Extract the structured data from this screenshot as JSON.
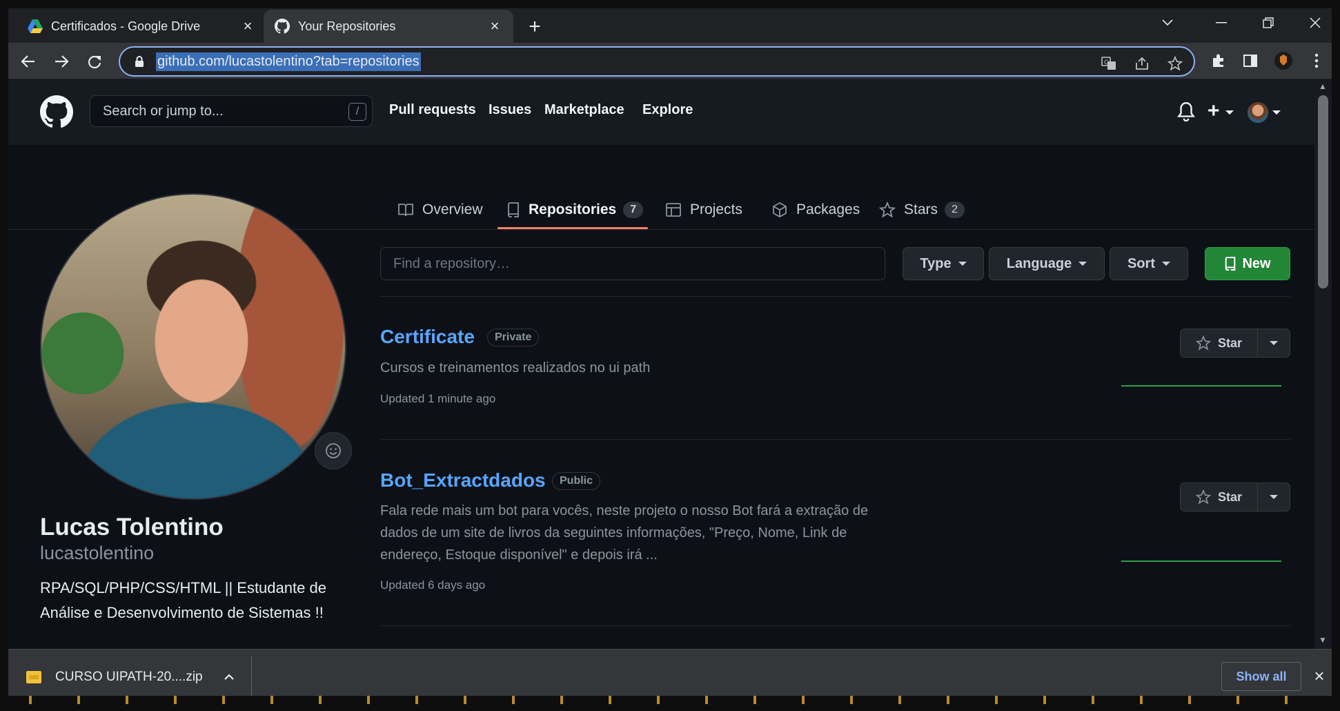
{
  "browser": {
    "tabs": [
      {
        "title": "Certificados - Google Drive",
        "icon": "google-drive-icon",
        "active": false
      },
      {
        "title": "Your Repositories",
        "icon": "github-icon",
        "active": true
      }
    ],
    "address": "github.com/lucastolentino?tab=repositories"
  },
  "github": {
    "search_placeholder": "Search or jump to...",
    "search_key": "/",
    "nav": [
      "Pull requests",
      "Issues",
      "Marketplace",
      "Explore"
    ]
  },
  "profile_tabs": [
    {
      "label": "Overview",
      "icon": "book-icon"
    },
    {
      "label": "Repositories",
      "icon": "repo-icon",
      "count": "7",
      "selected": true
    },
    {
      "label": "Projects",
      "icon": "table-icon"
    },
    {
      "label": "Packages",
      "icon": "package-icon"
    },
    {
      "label": "Stars",
      "icon": "star-icon",
      "count": "2"
    }
  ],
  "profile": {
    "name": "Lucas Tolentino",
    "login": "lucastolentino",
    "bio": "RPA/SQL/PHP/CSS/HTML || Estudante de Análise e Desenvolvimento de Sistemas !!"
  },
  "repo_toolbar": {
    "search_placeholder": "Find a repository…",
    "type_label": "Type",
    "language_label": "Language",
    "sort_label": "Sort",
    "new_label": "New"
  },
  "repos": [
    {
      "name": "Certificate",
      "visibility": "Private",
      "description": "Cursos e treinamentos realizados no ui path",
      "updated": "Updated 1 minute ago",
      "star_label": "Star"
    },
    {
      "name": "Bot_Extractdados",
      "visibility": "Public",
      "description": "Fala rede mais um bot para vocês, neste projeto o nosso Bot fará a extração de dados de um site de livros da seguintes informações, \"Preço, Nome, Link de endereço, Estoque disponível\" e depois irá ...",
      "updated": "Updated 6 days ago",
      "star_label": "Star"
    }
  ],
  "downloads": {
    "file": "CURSO UIPATH-20....zip",
    "show_all": "Show all"
  },
  "colors": {
    "accent_link": "#58a6ff",
    "tab_underline": "#f78166",
    "new_button": "#238636",
    "page_bg": "#0d1117"
  }
}
